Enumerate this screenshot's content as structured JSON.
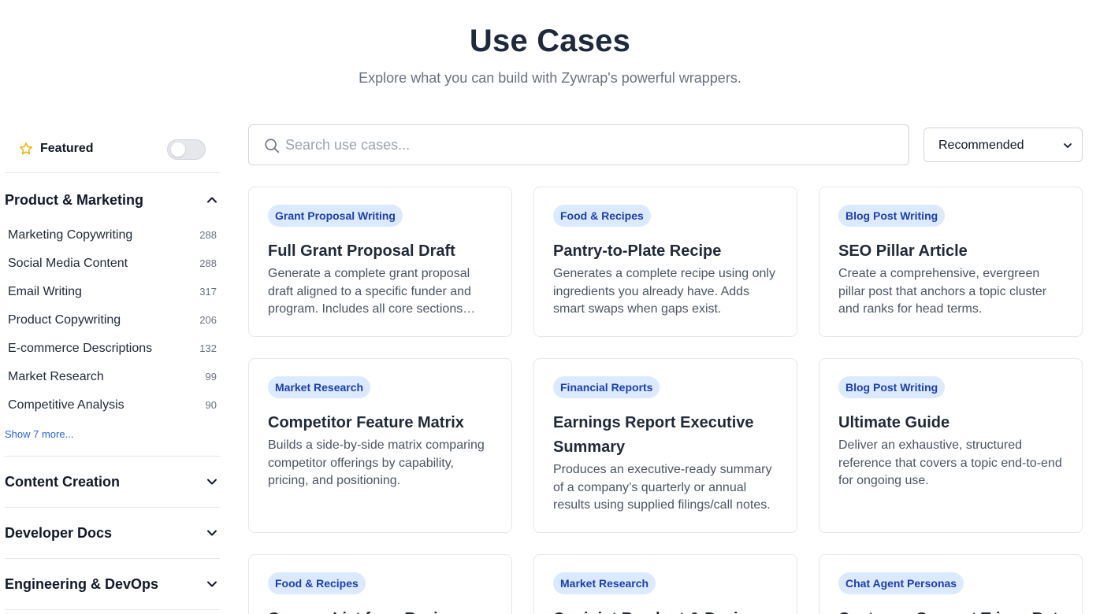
{
  "header": {
    "title": "Use Cases",
    "subtitle": "Explore what you can build with Zywrap's powerful wrappers."
  },
  "sidebar": {
    "featured_label": "Featured",
    "featured_enabled": false,
    "groups": [
      {
        "title": "Product & Marketing",
        "expanded": true,
        "items": [
          {
            "label": "Marketing Copywriting",
            "count": "288"
          },
          {
            "label": "Social Media Content",
            "count": "288"
          },
          {
            "label": "Email Writing",
            "count": "317"
          },
          {
            "label": "Product Copywriting",
            "count": "206"
          },
          {
            "label": "E-commerce Descriptions",
            "count": "132"
          },
          {
            "label": "Market Research",
            "count": "99"
          },
          {
            "label": "Competitive Analysis",
            "count": "90"
          }
        ],
        "show_more": "Show 7 more..."
      },
      {
        "title": "Content Creation",
        "expanded": false
      },
      {
        "title": "Developer Docs",
        "expanded": false
      },
      {
        "title": "Engineering & DevOps",
        "expanded": false
      }
    ]
  },
  "search": {
    "placeholder": "Search use cases...",
    "value": ""
  },
  "sort": {
    "selected": "Recommended"
  },
  "cards": [
    {
      "badge": "Grant Proposal Writing",
      "title": "Full Grant Proposal Draft",
      "description": "Generate a complete grant proposal draft aligned to a specific funder and program. Includes all core sections ready for submission."
    },
    {
      "badge": "Food & Recipes",
      "title": "Pantry-to-Plate Recipe",
      "description": "Generates a complete recipe using only ingredients you already have. Adds smart swaps when gaps exist."
    },
    {
      "badge": "Blog Post Writing",
      "title": "SEO Pillar Article",
      "description": "Create a comprehensive, evergreen pillar post that anchors a topic cluster and ranks for head terms."
    },
    {
      "badge": "Market Research",
      "title": "Competitor Feature Matrix",
      "description": "Builds a side-by-side matrix comparing competitor offerings by capability, pricing, and positioning."
    },
    {
      "badge": "Financial Reports",
      "title": "Earnings Report Executive Summary",
      "description": "Produces an executive-ready summary of a company’s quarterly or annual results using supplied filings/call notes."
    },
    {
      "badge": "Blog Post Writing",
      "title": "Ultimate Guide",
      "description": "Deliver an exhaustive, structured reference that covers a topic end-to-end for ongoing use."
    },
    {
      "badge": "Food & Recipes",
      "title": "Grocery List from Recipes",
      "description": ""
    },
    {
      "badge": "Market Research",
      "title": "Conjoint Readout & Design",
      "description": ""
    },
    {
      "badge": "Chat Agent Personas",
      "title": "Customer Support Triage Bot",
      "description": ""
    }
  ],
  "colors": {
    "badge_bg": "#dbeafe",
    "badge_text": "#1e40af",
    "link": "#2563eb",
    "star": "#eab308"
  }
}
